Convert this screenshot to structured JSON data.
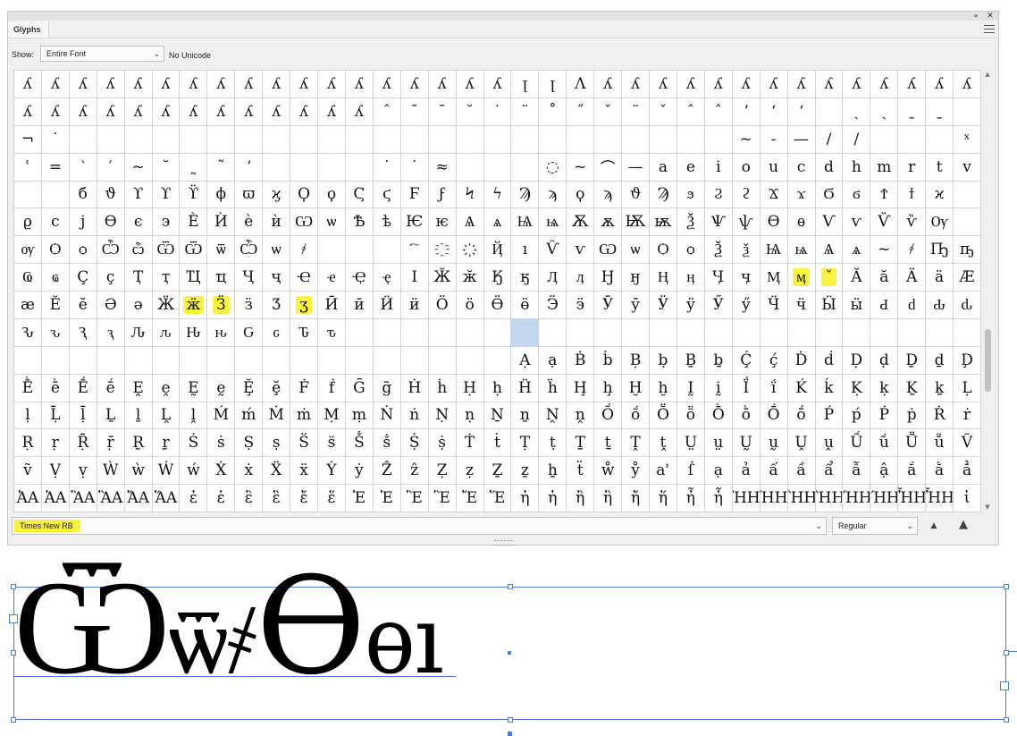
{
  "panel": {
    "tab_label": "Glyphs",
    "show_label": "Show:",
    "show_value": "Entire Font",
    "unicode_readout": "No Unicode",
    "font_name": "Times New RB",
    "font_style": "Regular"
  },
  "icons": {
    "collapse": "double-chevron-left-icon",
    "close": "close-icon",
    "panel_menu": "hamburger-menu-icon",
    "zoom_out": "small-mountain-icon",
    "zoom_in": "large-mountain-icon"
  },
  "highlight_color": "#f9f33e",
  "selection_color": "#c3d7ef",
  "highlighted_cells": [
    [
      8,
      6
    ],
    [
      8,
      7
    ],
    [
      8,
      10
    ],
    [
      7,
      28
    ],
    [
      7,
      29
    ]
  ],
  "selected_cell": [
    9,
    18
  ],
  "glyph_rows": [
    [
      "ʎ",
      "ʎ",
      "ʎ",
      "ʎ",
      "ʎ",
      "ʎ",
      "ʎ",
      "ʎ",
      "ʎ",
      "ʎ",
      "ʎ",
      "ʎ",
      "ʎ",
      "ʎ",
      "ʎ",
      "ʎ",
      "ʎ",
      "ʎ",
      "ꞁ",
      "ꞁ",
      "Λ",
      "ʎ",
      "ʎ",
      "ʎ",
      "ʎ",
      "ʎ",
      "ʎ",
      "ʎ",
      "ʎ",
      "ʎ",
      "ʎ",
      "ʎ",
      "ʎ",
      "ʎ",
      "ʎ"
    ],
    [
      "ʎ",
      "ʎ",
      "ʎ",
      "ʎ",
      "ʎ",
      "ʎ",
      "ʎ",
      "ʎ",
      "ʎ",
      "ʎ",
      "ʎ",
      "ʎ",
      "ʎ",
      "ˆ",
      "¯",
      "¯",
      "˘",
      "˙",
      "¨",
      "˚",
      "˝",
      "ˇ",
      "¨",
      "ˇ",
      "ˆ",
      "ˆ",
      "ʼ",
      "ʻ",
      "ʻ",
      "",
      "ˏ",
      "ˏ",
      "ˍ",
      "ˍ",
      ""
    ],
    [
      "¬",
      "˙",
      "",
      "",
      "",
      "",
      "",
      "",
      "",
      "",
      "",
      "",
      "",
      "",
      "",
      "",
      "",
      "",
      "",
      "",
      "",
      "",
      "",
      "",
      "",
      "",
      "~",
      "-",
      "—",
      "/",
      "/",
      "",
      "",
      "",
      "ˣ"
    ],
    [
      "ʿ",
      "=",
      "‵",
      "′",
      "~",
      "˘",
      "˷",
      "˜",
      "ʼ",
      "",
      "",
      "",
      "",
      "˙",
      "˙",
      "≈",
      "",
      "",
      "",
      "◌",
      "~",
      "⌒",
      "—",
      "a",
      "e",
      "i",
      "o",
      "u",
      "c",
      "d",
      "h",
      "m",
      "r",
      "t",
      "v",
      "x",
      "ʹ"
    ],
    [
      "",
      "",
      "б",
      "ϑ",
      "ϒ",
      "ϒ",
      "ϔ",
      "ϕ",
      "ϖ",
      "ϗ",
      "Ϙ",
      "ϙ",
      "Ϛ",
      "ϛ",
      "Ϝ",
      "ϝ",
      "Ϟ",
      "ϟ",
      "Ϡ",
      "ϡ",
      "ϙ",
      "ϡ",
      "ϑ",
      "Ϡ",
      "ϧ",
      "Ϩ",
      "ϩ",
      "Ϫ",
      "ϫ",
      "Ϭ",
      "ϭ",
      "Ϯ",
      "ϯ",
      "ϰ",
      ""
    ],
    [
      "ϱ",
      "ϲ",
      "ϳ",
      "ϴ",
      "ϵ",
      "϶",
      "Ѐ",
      "Ѝ",
      "ѐ",
      "ѝ",
      "Ѡ",
      "ѡ",
      "Ѣ",
      "ѣ",
      "Ѥ",
      "ѥ",
      "Ѧ",
      "ѧ",
      "Ѩ",
      "ѩ",
      "Ѫ",
      "ѫ",
      "Ѭ",
      "ѭ",
      "Ѯ",
      "Ѱ",
      "ѱ",
      "Ѳ",
      "ѳ",
      "Ѵ",
      "ѵ",
      "Ѷ",
      "ѷ",
      "Ѹ",
      ""
    ],
    [
      "ѹ",
      "Ѻ",
      "ѻ",
      "Ѽ",
      "ѽ",
      "Ѿ",
      "Ѿ",
      "ѿ",
      "Ѽ",
      "ѡ",
      "҂",
      "",
      "",
      "",
      "҇",
      "҈",
      "҉",
      "Ҋ",
      "ı",
      "Ѷ",
      "ѵ",
      "Ѡ",
      "ѡ",
      "Ѻ",
      "ѻ",
      "Ѯ",
      "ѯ",
      "Ѩ",
      "ѩ",
      "Ѧ",
      "ѧ",
      "~",
      "҂",
      "Ҧ",
      "ҧ"
    ],
    [
      "Ҩ",
      "ҩ",
      "Ҫ",
      "ҫ",
      "Ҭ",
      "ҭ",
      "Ҵ",
      "ҵ",
      "Ҷ",
      "ҷ",
      "Ҽ",
      "ҽ",
      "Ҿ",
      "ҿ",
      "Ӏ",
      "Ӂ",
      "ӂ",
      "Ӄ",
      "ӄ",
      "Ӆ",
      "ӆ",
      "Ӈ",
      "ӈ",
      "Ӊ",
      "ӊ",
      "Ӌ",
      "ӌ",
      "Ӎ",
      "ӎ",
      "ˇ",
      "Ӑ",
      "ӑ",
      "Ӓ",
      "ӓ",
      "Ӕ"
    ],
    [
      "ӕ",
      "Ӗ",
      "ӗ",
      "Ә",
      "ә",
      "Ӝ",
      "ӝ",
      "Ӟ",
      "ӟ",
      "Ӡ",
      "ӡ",
      "Ӣ",
      "ӣ",
      "Ӥ",
      "ӥ",
      "Ӧ",
      "ӧ",
      "Ӫ",
      "ӫ",
      "Ӭ",
      "ӭ",
      "Ӯ",
      "ӯ",
      "Ӱ",
      "ӱ",
      "Ӳ",
      "ӳ",
      "Ӵ",
      "ӵ",
      "Ӹ",
      "ӹ",
      "Ԁ",
      "ԁ",
      "Ԃ",
      "ԃ"
    ],
    [
      "Ԅ",
      "ԅ",
      "Ԇ",
      "ԇ",
      "Ԉ",
      "ԉ",
      "Ԋ",
      "ԋ",
      "Ԍ",
      "ԍ",
      "Ԏ",
      "ԏ",
      "",
      "",
      "",
      "",
      "",
      "",
      "",
      "",
      "",
      "",
      "",
      "",
      "",
      "",
      "",
      "",
      "",
      "",
      "",
      "",
      "",
      "",
      ""
    ],
    [
      "",
      "",
      "",
      "",
      "",
      "",
      "",
      "",
      "",
      "",
      "",
      "",
      "",
      "",
      "",
      "",
      "",
      "",
      "Ạ",
      "ạ",
      "Ḃ",
      "ḃ",
      "Ḅ",
      "ḅ",
      "Ḇ",
      "ḇ",
      "Ḉ",
      "ḉ",
      "Ḋ",
      "ḋ",
      "Ḍ",
      "ḍ",
      "Ḏ",
      "ḏ",
      "Ḑ"
    ],
    [
      "Ḕ",
      "ḕ",
      "Ḗ",
      "ḗ",
      "Ḙ",
      "ḙ",
      "Ḛ",
      "ḛ",
      "Ḝ",
      "ḝ",
      "Ḟ",
      "ḟ",
      "Ḡ",
      "ḡ",
      "Ḣ",
      "ḣ",
      "Ḥ",
      "ḥ",
      "Ḧ",
      "ḧ",
      "Ḩ",
      "ḩ",
      "Ḫ",
      "ḫ",
      "Ḭ",
      "ḭ",
      "Ḯ",
      "ḯ",
      "Ḱ",
      "ḱ",
      "Ḳ",
      "ḳ",
      "Ḵ",
      "ḵ",
      "Ḷ"
    ],
    [
      "ḷ",
      "Ḹ",
      "ḹ",
      "Ḻ",
      "ḻ",
      "Ḽ",
      "ḽ",
      "Ḿ",
      "ḿ",
      "Ṁ",
      "ṁ",
      "Ṃ",
      "ṃ",
      "Ṅ",
      "ṅ",
      "Ṇ",
      "ṇ",
      "Ṉ",
      "ṉ",
      "Ṋ",
      "ṋ",
      "Ṍ",
      "ṍ",
      "Ṏ",
      "ṏ",
      "Ṑ",
      "ṑ",
      "Ṓ",
      "ṓ",
      "Ṕ",
      "ṕ",
      "Ṗ",
      "ṗ",
      "Ṙ",
      "ṙ"
    ],
    [
      "Ṛ",
      "ṛ",
      "Ṝ",
      "ṝ",
      "Ṟ",
      "ṟ",
      "Ṡ",
      "ṡ",
      "Ṣ",
      "ṣ",
      "Ṥ",
      "ṥ",
      "Ṧ",
      "ṧ",
      "Ṩ",
      "ṩ",
      "Ṫ",
      "ṫ",
      "Ṭ",
      "ṭ",
      "Ṯ",
      "ṯ",
      "Ṱ",
      "ṱ",
      "Ṳ",
      "ṳ",
      "Ṵ",
      "ṵ",
      "Ṷ",
      "ṷ",
      "Ṹ",
      "ṹ",
      "Ṻ",
      "ṻ",
      "Ṽ"
    ],
    [
      "ṽ",
      "Ṿ",
      "ṿ",
      "Ẁ",
      "ẁ",
      "Ẃ",
      "ẃ",
      "Ẋ",
      "ẋ",
      "Ẍ",
      "ẍ",
      "Ẏ",
      "ẏ",
      "Ẑ",
      "ẑ",
      "Ẓ",
      "ẓ",
      "Ẕ",
      "ẕ",
      "ẖ",
      "ẗ",
      "ẘ",
      "ẙ",
      "ẚ",
      "ẛ",
      "ạ",
      "ả",
      "ấ",
      "ầ",
      "ẩ",
      "ẫ",
      "ậ",
      "ắ",
      "ằ",
      "ẳ"
    ],
    [
      "ἈΑ",
      "ἉΑ",
      "ἊΑ",
      "ἋΑ",
      "ἌΑ",
      "ἍΑ",
      "ἐ",
      "ἑ",
      "ἒ",
      "ἓ",
      "ἔ",
      "ἕ",
      "Ἐ",
      "Ἑ",
      "Ἒ",
      "Ἓ",
      "Ἔ",
      "Ἕ",
      "ἠ",
      "ἡ",
      "ἢ",
      "ἣ",
      "ἤ",
      "ἥ",
      "ἦ",
      "ἧ",
      "ἨΗ",
      "ἩΗ",
      "ἪΗ",
      "ἫΗ",
      "ἬΗ",
      "ἭΗ",
      "ἮΗ",
      "ἯΗ",
      "ἰ"
    ]
  ],
  "sample": {
    "glyph_1": "Ѿ",
    "glyph_2": "ѿ",
    "glyph_3": "҂",
    "glyph_4": "Ѳ",
    "glyph_5": "ѳ",
    "glyph_6": "ı"
  }
}
